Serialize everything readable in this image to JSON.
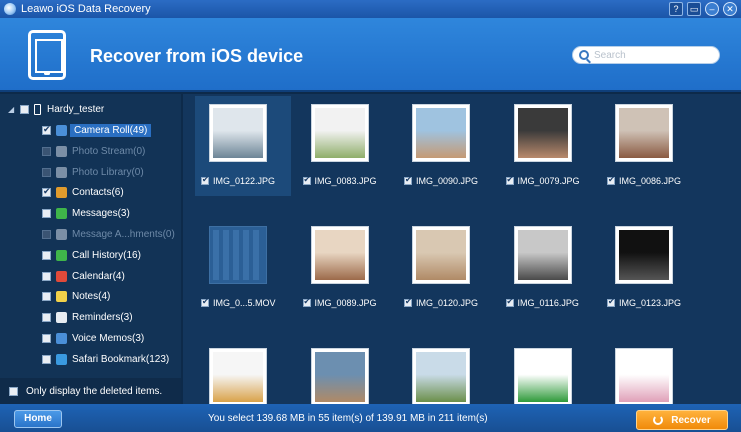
{
  "window": {
    "title": "Leawo iOS Data Recovery",
    "controls": [
      "?",
      "▭",
      "–",
      "✕"
    ]
  },
  "header": {
    "title": "Recover from iOS device",
    "search_placeholder": "Search"
  },
  "sidebar": {
    "device": "Hardy_tester",
    "items": [
      {
        "label": "Camera Roll(49)",
        "checked": true,
        "enabled": true,
        "active": true,
        "icon": "camera-icon",
        "color": "#4a8fd8"
      },
      {
        "label": "Photo Stream(0)",
        "checked": false,
        "enabled": false,
        "icon": "photo-stream-icon",
        "color": "#7b8fa6"
      },
      {
        "label": "Photo Library(0)",
        "checked": false,
        "enabled": false,
        "icon": "photo-library-icon",
        "color": "#7b8fa6"
      },
      {
        "label": "Contacts(6)",
        "checked": true,
        "enabled": true,
        "icon": "contacts-icon",
        "color": "#e09b2d"
      },
      {
        "label": "Messages(3)",
        "checked": false,
        "enabled": true,
        "icon": "messages-icon",
        "color": "#3fb54a"
      },
      {
        "label": "Message A...hments(0)",
        "checked": false,
        "enabled": false,
        "icon": "message-attachments-icon",
        "color": "#7b8fa6"
      },
      {
        "label": "Call History(16)",
        "checked": false,
        "enabled": true,
        "icon": "phone-icon",
        "color": "#3fb54a"
      },
      {
        "label": "Calendar(4)",
        "checked": false,
        "enabled": true,
        "icon": "calendar-icon",
        "color": "#e04a3a"
      },
      {
        "label": "Notes(4)",
        "checked": false,
        "enabled": true,
        "icon": "notes-icon",
        "color": "#f2d24a"
      },
      {
        "label": "Reminders(3)",
        "checked": false,
        "enabled": true,
        "icon": "reminders-icon",
        "color": "#e7ecf2"
      },
      {
        "label": "Voice Memos(3)",
        "checked": false,
        "enabled": true,
        "icon": "voice-memo-icon",
        "color": "#4a8fd8"
      },
      {
        "label": "Safari Bookmark(123)",
        "checked": false,
        "enabled": true,
        "icon": "safari-icon",
        "color": "#3a9ae0"
      }
    ],
    "footer_label": "Only display the deleted items."
  },
  "thumbnails": [
    {
      "name": "IMG_0122.JPG",
      "checked": true,
      "selected": true,
      "colors": [
        "#dfe6ec",
        "#6d8596"
      ]
    },
    {
      "name": "IMG_0083.JPG",
      "checked": true,
      "colors": [
        "#f2f2f2",
        "#8fae6a"
      ]
    },
    {
      "name": "IMG_0090.JPG",
      "checked": true,
      "colors": [
        "#9fc3e0",
        "#c59a74"
      ]
    },
    {
      "name": "IMG_0079.JPG",
      "checked": true,
      "colors": [
        "#3a3a3a",
        "#b98a6c"
      ]
    },
    {
      "name": "IMG_0086.JPG",
      "checked": true,
      "colors": [
        "#cfc2b6",
        "#8a5a42"
      ]
    },
    {
      "name": "IMG_0...5.MOV",
      "checked": true,
      "video": true,
      "colors": [
        "#2b5f96",
        "#3a70a8"
      ]
    },
    {
      "name": "IMG_0089.JPG",
      "checked": true,
      "colors": [
        "#e8d6c2",
        "#9c6a4a"
      ]
    },
    {
      "name": "IMG_0120.JPG",
      "checked": true,
      "colors": [
        "#d9c8b2",
        "#b08a66"
      ]
    },
    {
      "name": "IMG_0116.JPG",
      "checked": true,
      "colors": [
        "#c8c8c8",
        "#4a4a4a"
      ]
    },
    {
      "name": "IMG_0123.JPG",
      "checked": true,
      "colors": [
        "#111111",
        "#555555"
      ]
    },
    {
      "name": "",
      "checked": false,
      "colors": [
        "#f6f6f6",
        "#d9a24a"
      ]
    },
    {
      "name": "",
      "checked": false,
      "colors": [
        "#6c8fb0",
        "#b08a66"
      ]
    },
    {
      "name": "",
      "checked": false,
      "colors": [
        "#c9dbe8",
        "#6b8f4a"
      ]
    },
    {
      "name": "",
      "checked": false,
      "colors": [
        "#ffffff",
        "#2f9a3a"
      ]
    },
    {
      "name": "",
      "checked": false,
      "colors": [
        "#ffffff",
        "#e0a0b8"
      ]
    }
  ],
  "status": {
    "home_label": "Home",
    "summary": "You select 139.68 MB in 55 item(s) of 139.91 MB in 211 item(s)",
    "recover_label": "Recover"
  }
}
